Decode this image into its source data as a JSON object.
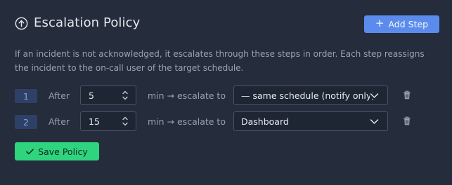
{
  "header": {
    "title": "Escalation Policy",
    "icon": "arrow-up-circle-icon",
    "add_step_label": "Add Step"
  },
  "description": "If an incident is not acknowledged, it escalates through these steps in order. Each step reassigns the incident to the on-call user of the target schedule.",
  "steps": [
    {
      "number": "1",
      "after_label": "After",
      "minutes": "5",
      "escalate_label": "min → escalate to",
      "target": "— same schedule (notify only)"
    },
    {
      "number": "2",
      "after_label": "After",
      "minutes": "15",
      "escalate_label": "min → escalate to",
      "target": "Dashboard"
    }
  ],
  "save_label": "Save Policy",
  "colors": {
    "background": "#252c3b",
    "primary": "#5b8ced",
    "success": "#2fd47f",
    "badge_bg": "#2e4066"
  }
}
